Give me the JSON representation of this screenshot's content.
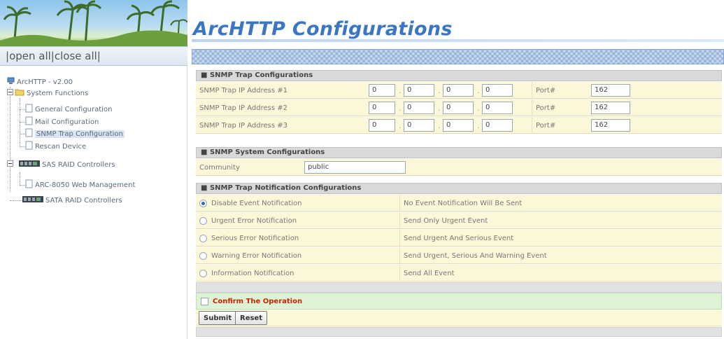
{
  "header": {
    "title": "ArcHTTP Configurations",
    "open_all": "open all",
    "close_all": "close all",
    "separator": "|"
  },
  "tree": {
    "root": "ArcHTTP - v2.00",
    "system_functions": "System Functions",
    "general_config": "General Configuration",
    "mail_config": "Mail Configuration",
    "snmp_trap_config": "SNMP Trap Configuration",
    "rescan": "Rescan Device",
    "sas_raid": "SAS RAID Controllers",
    "arc_web": "ARC-8050 Web Management",
    "sata_raid": "SATA RAID Controllers"
  },
  "snmp_trap": {
    "heading": "SNMP Trap Configurations",
    "port_label": "Port#",
    "rows": [
      {
        "label": "SNMP Trap IP Address #1",
        "ip": [
          "0",
          "0",
          "0",
          "0"
        ],
        "port": "162"
      },
      {
        "label": "SNMP Trap IP Address #2",
        "ip": [
          "0",
          "0",
          "0",
          "0"
        ],
        "port": "162"
      },
      {
        "label": "SNMP Trap IP Address #3",
        "ip": [
          "0",
          "0",
          "0",
          "0"
        ],
        "port": "162"
      }
    ]
  },
  "snmp_system": {
    "heading": "SNMP System Configurations",
    "community_label": "Community",
    "community_value": "public"
  },
  "notifications": {
    "heading": "SNMP Trap Notification Configurations",
    "selected_index": 0,
    "options": [
      {
        "label": "Disable Event Notification",
        "desc": "No Event Notification Will Be Sent"
      },
      {
        "label": "Urgent Error Notification",
        "desc": "Send Only Urgent Event"
      },
      {
        "label": "Serious Error Notification",
        "desc": "Send Urgent And Serious Event"
      },
      {
        "label": "Warning Error Notification",
        "desc": "Send Urgent, Serious And Warning Event"
      },
      {
        "label": "Information Notification",
        "desc": "Send All Event"
      }
    ]
  },
  "confirm": {
    "label": "Confirm The Operation",
    "color": "#cc2200"
  },
  "buttons": {
    "submit": "Submit",
    "reset": "Reset"
  },
  "colors": {
    "title": "#3a76c4",
    "row_bg": "#fdf7d9",
    "confirm_bg": "#ddf3d6",
    "radio_selected": "#2e6bc0"
  }
}
